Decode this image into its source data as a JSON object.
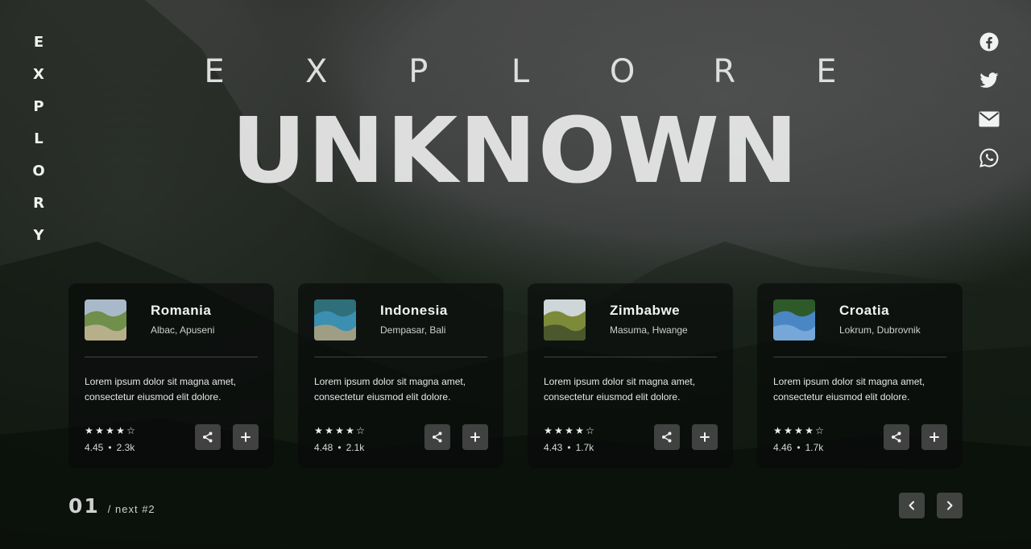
{
  "brand": {
    "letters": [
      "E",
      "X",
      "P",
      "L",
      "O",
      "R",
      "Y"
    ]
  },
  "hero": {
    "kicker_letters": [
      "E",
      "X",
      "P",
      "L",
      "O",
      "R",
      "E"
    ],
    "title": "UNKNOWN"
  },
  "social": [
    {
      "icon": "facebook-icon"
    },
    {
      "icon": "twitter-icon"
    },
    {
      "icon": "envelope-icon"
    },
    {
      "icon": "whatsapp-icon"
    }
  ],
  "cards": [
    {
      "country": "Romania",
      "place": "Albac, Apuseni",
      "description": "Lorem ipsum dolor sit magna amet, consectetur eiusmod elit dolore.",
      "stars_filled": 4,
      "stars_total": 5,
      "rating": "4.45",
      "separator": "•",
      "reviews": "2.3k",
      "thumb_colors": [
        "#6f8f4a",
        "#a9b9c9",
        "#c9b79a"
      ]
    },
    {
      "country": "Indonesia",
      "place": "Dempasar, Bali",
      "description": "Lorem ipsum dolor sit magna amet, consectetur eiusmod elit dolore.",
      "stars_filled": 4,
      "stars_total": 5,
      "rating": "4.48",
      "separator": "•",
      "reviews": "2.1k",
      "thumb_colors": [
        "#3b8fb1",
        "#2f6f7a",
        "#b9a17a"
      ]
    },
    {
      "country": "Zimbabwe",
      "place": "Masuma, Hwange",
      "description": "Lorem ipsum dolor sit magna amet, consectetur eiusmod elit dolore.",
      "stars_filled": 4,
      "stars_total": 5,
      "rating": "4.43",
      "separator": "•",
      "reviews": "1.7k",
      "thumb_colors": [
        "#7c8a3a",
        "#cfd6d8",
        "#3f4a2a"
      ]
    },
    {
      "country": "Croatia",
      "place": "Lokrum, Dubrovnik",
      "description": "Lorem ipsum dolor sit magna amet, consectetur eiusmod elit dolore.",
      "stars_filled": 4,
      "stars_total": 5,
      "rating": "4.46",
      "separator": "•",
      "reviews": "1.7k",
      "thumb_colors": [
        "#4a86c4",
        "#2e5a2a",
        "#7fb0de"
      ]
    }
  ],
  "pager": {
    "current": "01",
    "next_label": "/ next #2"
  },
  "icons": {
    "share": "share-icon",
    "add": "plus-icon",
    "prev": "chevron-left-icon",
    "next": "chevron-right-icon",
    "star_filled": "star-filled-icon",
    "star_empty": "star-outline-icon"
  }
}
